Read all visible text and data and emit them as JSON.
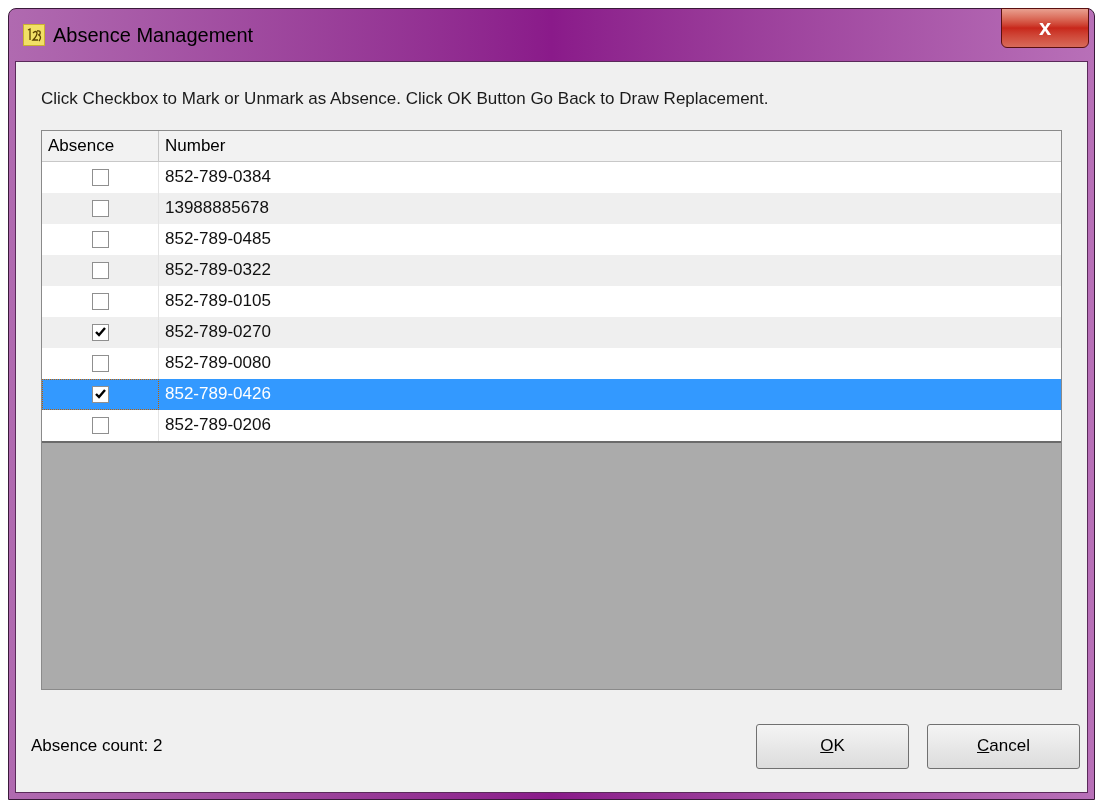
{
  "window": {
    "title": "Absence Management",
    "close_glyph": "x"
  },
  "instruction": "Click Checkbox to Mark or Unmark as Absence. Click OK Button Go Back to Draw Replacement.",
  "table": {
    "columns": [
      "Absence",
      "Number"
    ],
    "rows": [
      {
        "checked": false,
        "number": "852-789-0384",
        "selected": false
      },
      {
        "checked": false,
        "number": "13988885678",
        "selected": false
      },
      {
        "checked": false,
        "number": "852-789-0485",
        "selected": false
      },
      {
        "checked": false,
        "number": "852-789-0322",
        "selected": false
      },
      {
        "checked": false,
        "number": "852-789-0105",
        "selected": false
      },
      {
        "checked": true,
        "number": "852-789-0270",
        "selected": false
      },
      {
        "checked": false,
        "number": "852-789-0080",
        "selected": false
      },
      {
        "checked": true,
        "number": "852-789-0426",
        "selected": true
      },
      {
        "checked": false,
        "number": "852-789-0206",
        "selected": false
      }
    ]
  },
  "footer": {
    "count_label": "Absence count: 2"
  },
  "buttons": [
    {
      "access_key": "O",
      "rest": "K"
    },
    {
      "access_key": "C",
      "rest": "ancel"
    }
  ]
}
